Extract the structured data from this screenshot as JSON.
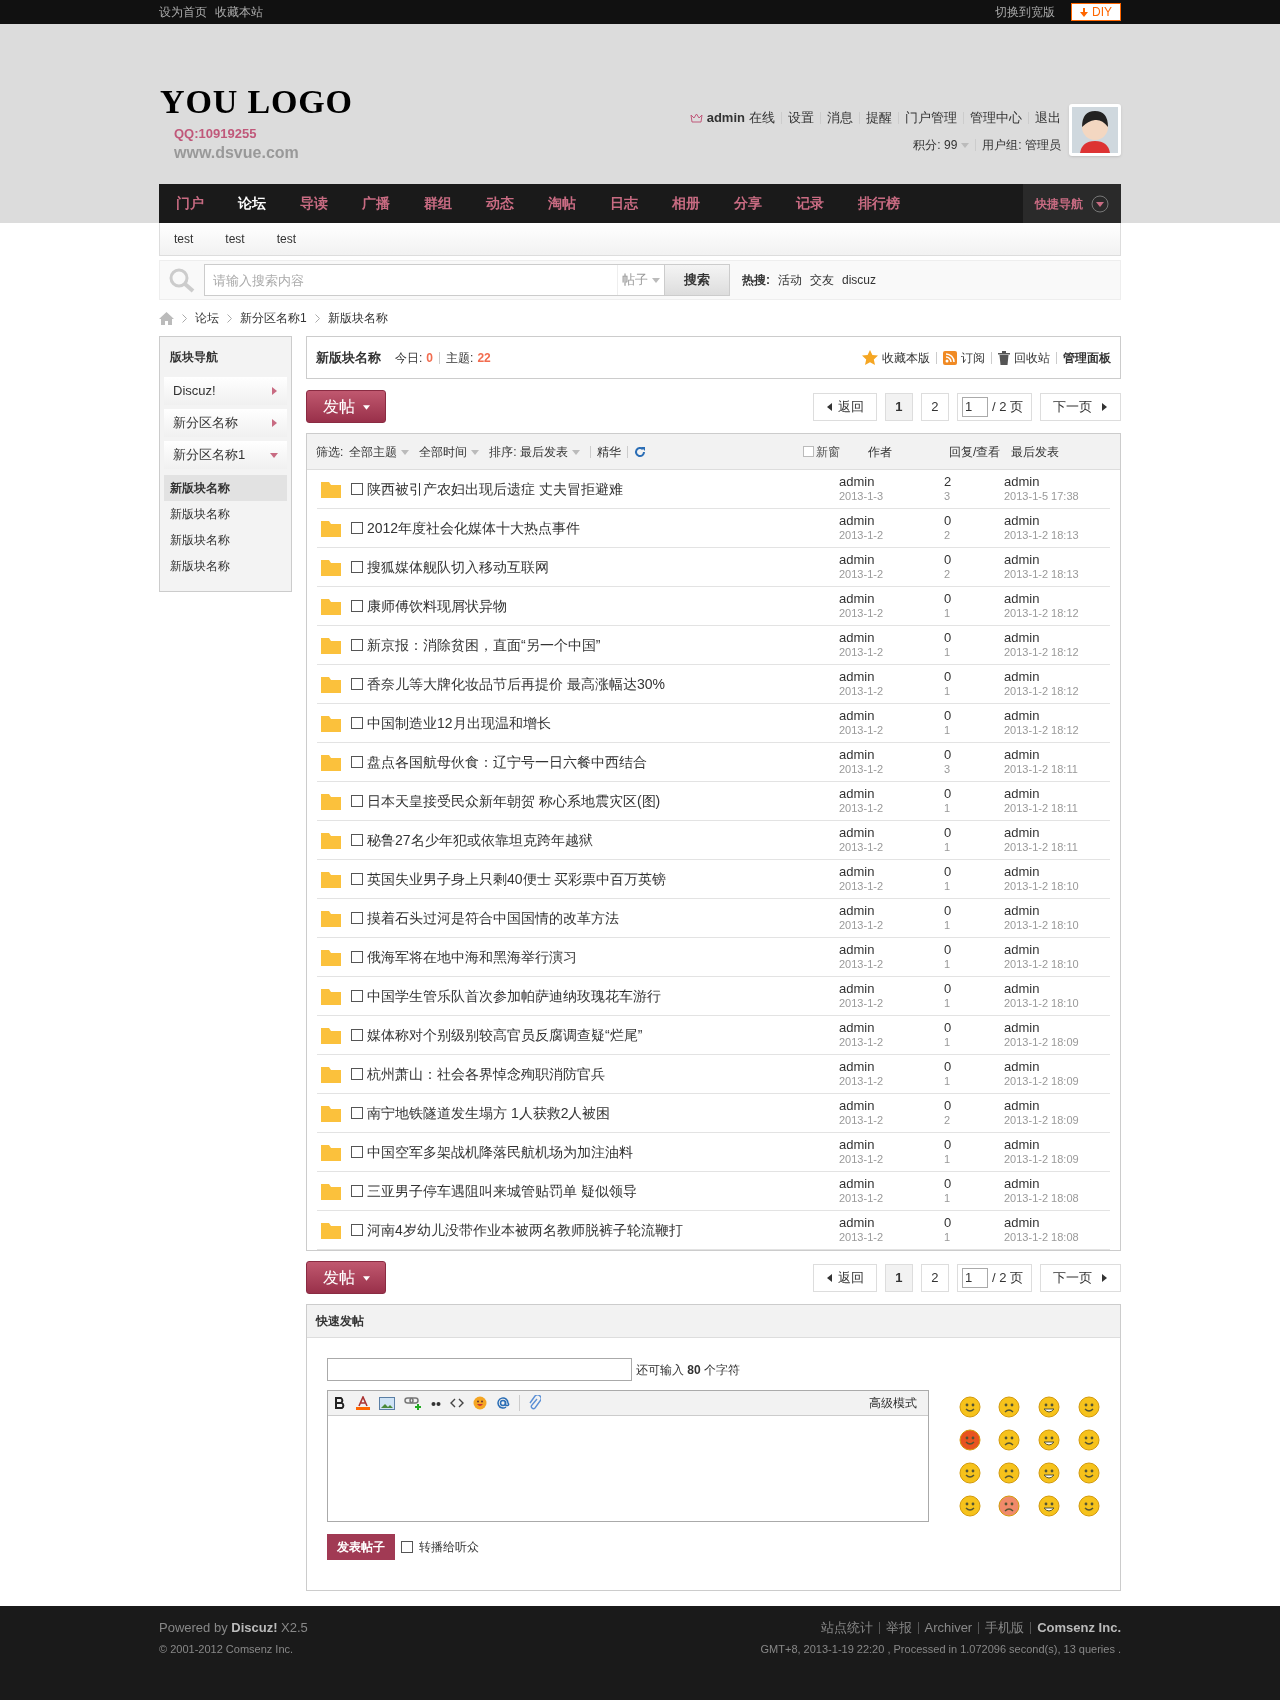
{
  "top_bar": {
    "links": [
      "设为首页",
      "收藏本站"
    ],
    "wide_toggle": "切换到宽版",
    "diy": "DIY"
  },
  "header": {
    "logo": "YOU LOGO",
    "qq": "QQ:10919255",
    "url": "www.dsvue.com",
    "user": {
      "name": "admin",
      "status": "在线"
    },
    "links": [
      "设置",
      "消息",
      "提醒",
      "门户管理",
      "管理中心",
      "退出"
    ],
    "credits": "积分: 99",
    "group": "用户组: 管理员"
  },
  "nav": {
    "items": [
      {
        "label": "门户",
        "selected": false
      },
      {
        "label": "论坛",
        "selected": true
      },
      {
        "label": "导读",
        "selected": false
      },
      {
        "label": "广播",
        "selected": false
      },
      {
        "label": "群组",
        "selected": false
      },
      {
        "label": "动态",
        "selected": false
      },
      {
        "label": "淘帖",
        "selected": false
      },
      {
        "label": "日志",
        "selected": false
      },
      {
        "label": "相册",
        "selected": false
      },
      {
        "label": "分享",
        "selected": false
      },
      {
        "label": "记录",
        "selected": false
      },
      {
        "label": "排行榜",
        "selected": false
      }
    ],
    "quick_nav": "快捷导航"
  },
  "subnav": [
    "test",
    "test",
    "test"
  ],
  "search": {
    "placeholder": "请输入搜索内容",
    "type": "帖子",
    "button": "搜索",
    "hot_label": "热搜:",
    "hot": [
      "活动",
      "交友",
      "discuz"
    ]
  },
  "breadcrumb": [
    "论坛",
    "新分区名称1",
    "新版块名称"
  ],
  "sidebar": {
    "title": "版块导航",
    "groups": [
      {
        "label": "Discuz!",
        "expanded": false
      },
      {
        "label": "新分区名称",
        "expanded": false
      },
      {
        "label": "新分区名称1",
        "expanded": true
      }
    ],
    "items": [
      {
        "label": "新版块名称",
        "selected": true
      },
      {
        "label": "新版块名称",
        "selected": false
      },
      {
        "label": "新版块名称",
        "selected": false
      },
      {
        "label": "新版块名称",
        "selected": false
      }
    ]
  },
  "forum_header": {
    "name": "新版块名称",
    "today_label": "今日:",
    "today": "0",
    "topics_label": "主题:",
    "topics": "22",
    "actions": [
      {
        "kind": "star",
        "label": "收藏本版"
      },
      {
        "kind": "rss",
        "label": "订阅"
      },
      {
        "kind": "trash",
        "label": "回收站"
      },
      {
        "kind": "plain",
        "label": "管理面板"
      }
    ]
  },
  "toolbars": [
    {
      "post_button": "发帖",
      "back": "返回",
      "pages": [
        {
          "label": "1",
          "selected": true
        },
        {
          "label": "2",
          "selected": false
        }
      ],
      "page_input": "1",
      "total": "/ 2 页",
      "next": "下一页"
    },
    {
      "post_button": "发帖",
      "back": "返回",
      "pages": [
        {
          "label": "1",
          "selected": true
        },
        {
          "label": "2",
          "selected": false
        }
      ],
      "page_input": "1",
      "total": "/ 2 页",
      "next": "下一页"
    }
  ],
  "filter": {
    "label": "筛选:",
    "dropdowns": [
      "全部主题",
      "全部时间",
      "排序: 最后发表"
    ],
    "digest": "精华",
    "new_window": {
      "label": "新窗",
      "checked": false
    },
    "columns": [
      "作者",
      "回复/查看",
      "最后发表"
    ]
  },
  "threads": [
    {
      "checked": false,
      "title": "陕西被引产农妇出现后遗症 丈夫冒拒避难",
      "author": "admin",
      "date": "2013-1-3",
      "replies": "2",
      "views": "3",
      "last_author": "admin",
      "last_time": "2013-1-5 17:38"
    },
    {
      "checked": false,
      "title": "2012年度社会化媒体十大热点事件",
      "author": "admin",
      "date": "2013-1-2",
      "replies": "0",
      "views": "2",
      "last_author": "admin",
      "last_time": "2013-1-2 18:13"
    },
    {
      "checked": false,
      "title": "搜狐媒体舰队切入移动互联网",
      "author": "admin",
      "date": "2013-1-2",
      "replies": "0",
      "views": "2",
      "last_author": "admin",
      "last_time": "2013-1-2 18:13"
    },
    {
      "checked": false,
      "title": "康师傅饮料现屑状异物",
      "author": "admin",
      "date": "2013-1-2",
      "replies": "0",
      "views": "1",
      "last_author": "admin",
      "last_time": "2013-1-2 18:12"
    },
    {
      "checked": false,
      "title": "新京报：消除贫困，直面“另一个中国”",
      "author": "admin",
      "date": "2013-1-2",
      "replies": "0",
      "views": "1",
      "last_author": "admin",
      "last_time": "2013-1-2 18:12"
    },
    {
      "checked": false,
      "title": "香奈儿等大牌化妆品节后再提价 最高涨幅达30%",
      "author": "admin",
      "date": "2013-1-2",
      "replies": "0",
      "views": "1",
      "last_author": "admin",
      "last_time": "2013-1-2 18:12"
    },
    {
      "checked": false,
      "title": "中国制造业12月出现温和增长",
      "author": "admin",
      "date": "2013-1-2",
      "replies": "0",
      "views": "1",
      "last_author": "admin",
      "last_time": "2013-1-2 18:12"
    },
    {
      "checked": false,
      "title": "盘点各国航母伙食：辽宁号一日六餐中西结合",
      "author": "admin",
      "date": "2013-1-2",
      "replies": "0",
      "views": "3",
      "last_author": "admin",
      "last_time": "2013-1-2 18:11"
    },
    {
      "checked": false,
      "title": "日本天皇接受民众新年朝贺 称心系地震灾区(图)",
      "author": "admin",
      "date": "2013-1-2",
      "replies": "0",
      "views": "1",
      "last_author": "admin",
      "last_time": "2013-1-2 18:11"
    },
    {
      "checked": false,
      "title": "秘鲁27名少年犯或依靠坦克跨年越狱",
      "author": "admin",
      "date": "2013-1-2",
      "replies": "0",
      "views": "1",
      "last_author": "admin",
      "last_time": "2013-1-2 18:11"
    },
    {
      "checked": false,
      "title": "英国失业男子身上只剩40便士 买彩票中百万英镑",
      "author": "admin",
      "date": "2013-1-2",
      "replies": "0",
      "views": "1",
      "last_author": "admin",
      "last_time": "2013-1-2 18:10"
    },
    {
      "checked": false,
      "title": "摸着石头过河是符合中国国情的改革方法",
      "author": "admin",
      "date": "2013-1-2",
      "replies": "0",
      "views": "1",
      "last_author": "admin",
      "last_time": "2013-1-2 18:10"
    },
    {
      "checked": false,
      "title": "俄海军将在地中海和黑海举行演习",
      "author": "admin",
      "date": "2013-1-2",
      "replies": "0",
      "views": "1",
      "last_author": "admin",
      "last_time": "2013-1-2 18:10"
    },
    {
      "checked": false,
      "title": "中国学生管乐队首次参加帕萨迪纳玫瑰花车游行",
      "author": "admin",
      "date": "2013-1-2",
      "replies": "0",
      "views": "1",
      "last_author": "admin",
      "last_time": "2013-1-2 18:10"
    },
    {
      "checked": false,
      "title": "媒体称对个别级别较高官员反腐调查疑“烂尾”",
      "author": "admin",
      "date": "2013-1-2",
      "replies": "0",
      "views": "1",
      "last_author": "admin",
      "last_time": "2013-1-2 18:09"
    },
    {
      "checked": false,
      "title": "杭州萧山：社会各界悼念殉职消防官兵",
      "author": "admin",
      "date": "2013-1-2",
      "replies": "0",
      "views": "1",
      "last_author": "admin",
      "last_time": "2013-1-2 18:09"
    },
    {
      "checked": false,
      "title": "南宁地铁隧道发生塌方 1人获救2人被困",
      "author": "admin",
      "date": "2013-1-2",
      "replies": "0",
      "views": "2",
      "last_author": "admin",
      "last_time": "2013-1-2 18:09"
    },
    {
      "checked": false,
      "title": "中国空军多架战机降落民航机场为加注油料",
      "author": "admin",
      "date": "2013-1-2",
      "replies": "0",
      "views": "1",
      "last_author": "admin",
      "last_time": "2013-1-2 18:09"
    },
    {
      "checked": false,
      "title": "三亚男子停车遇阻叫来城管贴罚单 疑似领导",
      "author": "admin",
      "date": "2013-1-2",
      "replies": "0",
      "views": "1",
      "last_author": "admin",
      "last_time": "2013-1-2 18:08"
    },
    {
      "checked": false,
      "title": "河南4岁幼儿没带作业本被两名教师脱裤子轮流鞭打",
      "author": "admin",
      "date": "2013-1-2",
      "replies": "0",
      "views": "1",
      "last_author": "admin",
      "last_time": "2013-1-2 18:08"
    }
  ],
  "quick_post": {
    "title": "快速发帖",
    "counter": "还可输入 **80** 个字符",
    "advanced": "高级模式",
    "submit": "发表帖子",
    "share": {
      "label": "转播给听众",
      "checked": false
    }
  },
  "footer": {
    "powered": "Powered by **Discuz!** X2.5",
    "copyright": "© 2001-2012 Comsenz Inc.",
    "links": [
      {
        "label": "站点统计",
        "bold": false
      },
      {
        "label": "举报",
        "bold": false
      },
      {
        "label": "Archiver",
        "bold": false
      },
      {
        "label": "手机版",
        "bold": false
      },
      {
        "label": "Comsenz Inc.",
        "bold": true
      }
    ],
    "stats": "GMT+8, 2013-1-19 22:20 , Processed in 1.072096 second(s), 13 queries ."
  }
}
